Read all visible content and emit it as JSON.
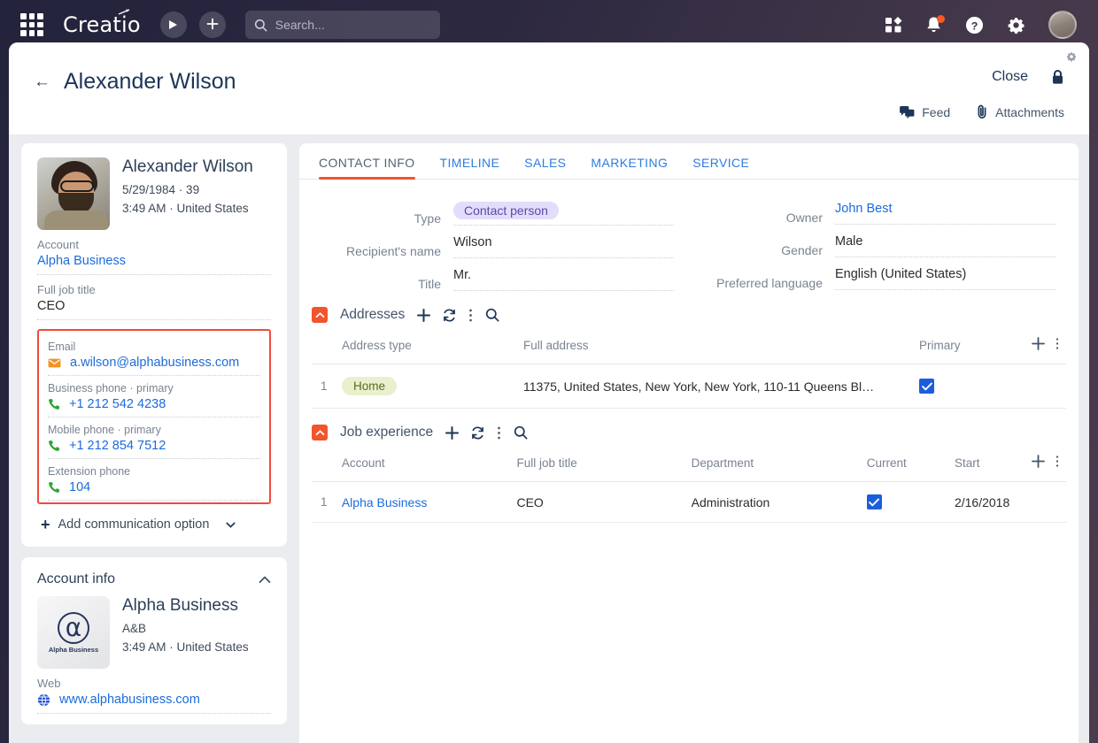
{
  "topbar": {
    "brand": "Creatio",
    "search_placeholder": "Search...",
    "apps_icon": "apps-grid-icon",
    "play_icon": "play-icon",
    "add_icon": "plus-icon",
    "search_icon": "search-icon",
    "dashboard_icon": "dashboard-icon",
    "notification_icon": "bell-icon",
    "help_icon": "help-icon",
    "settings_icon": "gear-icon",
    "avatar_icon": "user-avatar"
  },
  "page": {
    "title": "Alexander Wilson",
    "back_icon": "back-arrow-icon",
    "close_label": "Close",
    "lock_icon": "lock-icon",
    "gear_icon": "gear-icon",
    "feed_label": "Feed",
    "feed_icon": "feed-icon",
    "attachments_label": "Attachments",
    "attachments_icon": "paperclip-icon"
  },
  "sidebar": {
    "contact": {
      "name": "Alexander Wilson",
      "birth": "5/29/1984 · 39",
      "localtime": "3:49 AM · United States",
      "fields": [
        {
          "label": "Account",
          "value": "Alpha Business",
          "link": true
        },
        {
          "label": "Full job title",
          "value": "CEO",
          "link": false
        }
      ]
    },
    "communications": [
      {
        "label": "Email",
        "value": "a.wilson@alphabusiness.com",
        "icon": "email-icon"
      },
      {
        "label": "Business phone · primary",
        "value": "+1 212 542 4238",
        "icon": "phone-icon"
      },
      {
        "label": "Mobile phone · primary",
        "value": "+1 212 854 7512",
        "icon": "phone-icon"
      },
      {
        "label": "Extension phone",
        "value": "104",
        "icon": "phone-icon"
      }
    ],
    "add_communication_label": "Add communication option",
    "account_info": {
      "section_title": "Account info",
      "logo_mark": "⍺",
      "logo_caption": "Alpha Business",
      "name": "Alpha Business",
      "alias": "A&B",
      "localtime": "3:49 AM · United States",
      "web_label": "Web",
      "web_value": "www.alphabusiness.com"
    }
  },
  "main": {
    "tabs": [
      {
        "label": "CONTACT INFO",
        "active": true
      },
      {
        "label": "TIMELINE",
        "active": false
      },
      {
        "label": "SALES",
        "active": false
      },
      {
        "label": "MARKETING",
        "active": false
      },
      {
        "label": "SERVICE",
        "active": false
      }
    ],
    "form_left": [
      {
        "label": "Type",
        "value": "Contact person",
        "style": "pill"
      },
      {
        "label": "Recipient's name",
        "value": "Wilson",
        "style": "text"
      },
      {
        "label": "Title",
        "value": "Mr.",
        "style": "text"
      }
    ],
    "form_right": [
      {
        "label": "Owner",
        "value": "John Best",
        "style": "link"
      },
      {
        "label": "Gender",
        "value": "Male",
        "style": "text"
      },
      {
        "label": "Preferred language",
        "value": "English (United States)",
        "style": "text"
      }
    ],
    "addresses": {
      "title": "Addresses",
      "columns": [
        "Address type",
        "Full address",
        "Primary"
      ],
      "rows": [
        {
          "num": "1",
          "type": "Home",
          "full_address": "11375, United States, New York, New York, 110-11 Queens Blvd, ...",
          "primary": true
        }
      ]
    },
    "job_experience": {
      "title": "Job experience",
      "columns": [
        "Account",
        "Full job title",
        "Department",
        "Current",
        "Start"
      ],
      "rows": [
        {
          "num": "1",
          "account": "Alpha Business",
          "job_title": "CEO",
          "department": "Administration",
          "current": true,
          "start": "2/16/2018"
        }
      ]
    },
    "toolbar_icons": {
      "collapse": "chevron-up-icon",
      "add": "plus-icon",
      "refresh": "refresh-icon",
      "more": "more-vertical-icon",
      "search": "search-icon"
    }
  },
  "colors": {
    "accent_orange": "#f2542d",
    "link_blue": "#1b6bdd",
    "highlight_border": "#f04b3c",
    "checkbox_blue": "#1b5edd",
    "tag_green_bg": "#e8f0cd",
    "pill_purple_bg": "#e3dcfb"
  }
}
